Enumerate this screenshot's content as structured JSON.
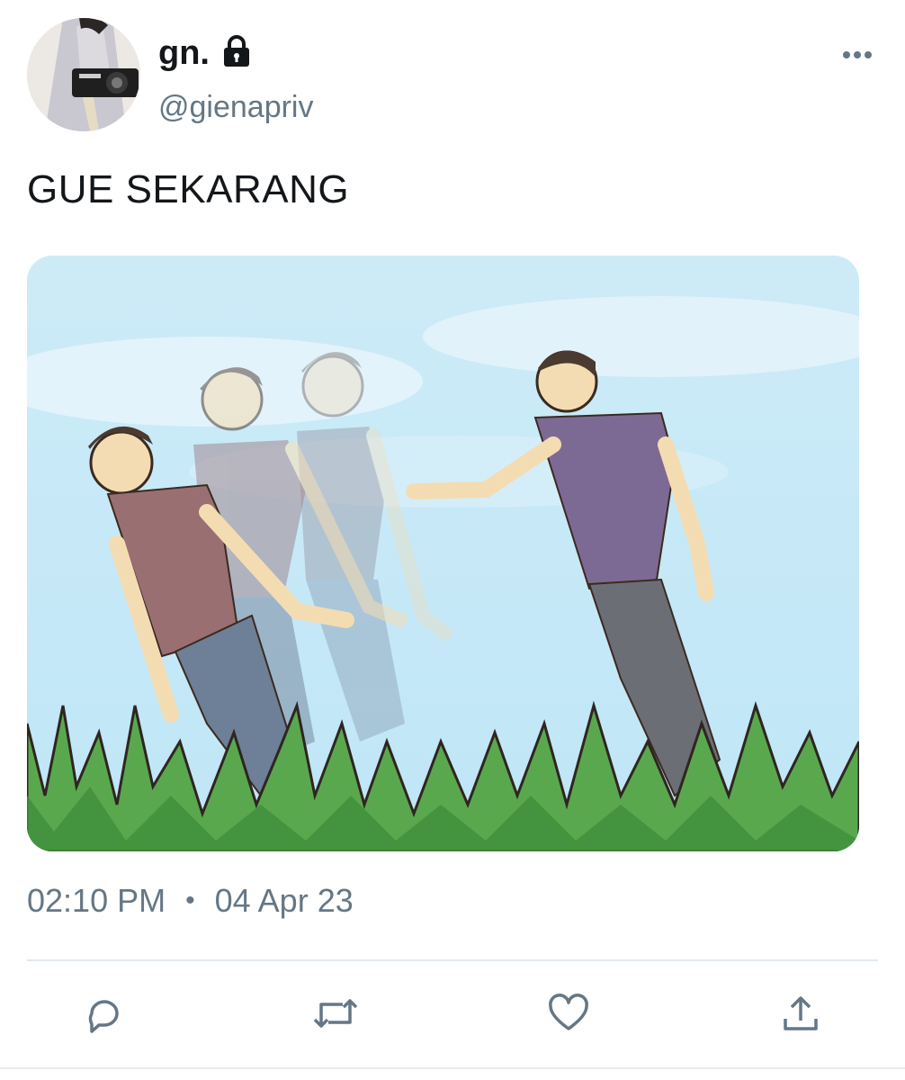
{
  "user": {
    "display_name": "gn.",
    "handle": "@gienapriv",
    "protected": true,
    "avatar": "profile-photo",
    "lock_icon": "lock-icon"
  },
  "tweet": {
    "text": "GUE SEKARANG",
    "media": "image-illustration",
    "time": "02:10 PM",
    "separator": "•",
    "date": "04 Apr 23"
  },
  "actions": [
    {
      "name": "reply",
      "icon": "comment-icon"
    },
    {
      "name": "retweet",
      "icon": "retweet-icon"
    },
    {
      "name": "like",
      "icon": "heart-icon"
    },
    {
      "name": "share",
      "icon": "share-icon"
    }
  ],
  "colors": {
    "text": "#14171a",
    "secondary": "#657786",
    "divider": "#e1e8ed"
  }
}
